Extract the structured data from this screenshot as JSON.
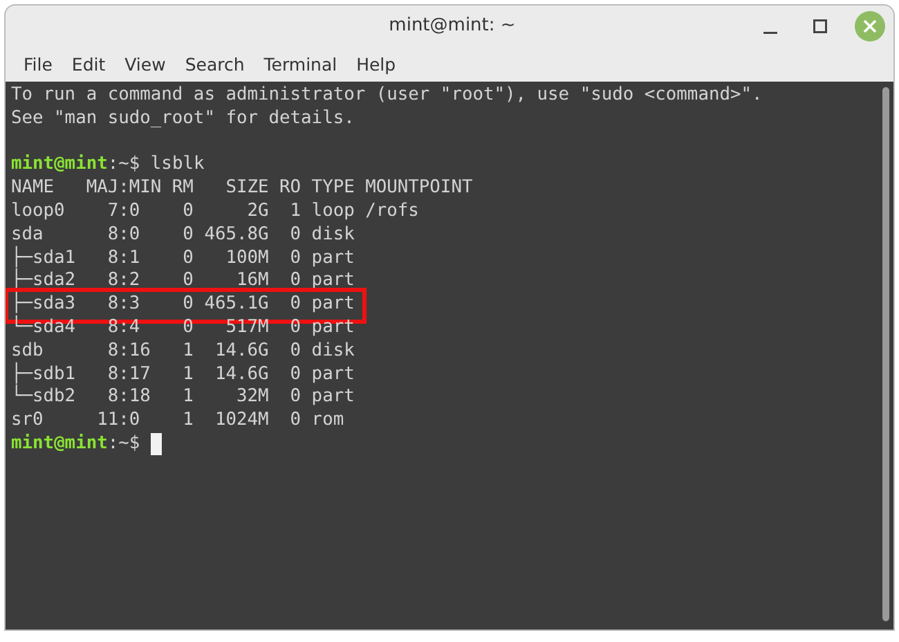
{
  "window": {
    "title": "mint@mint: ~"
  },
  "menu": [
    "File",
    "Edit",
    "View",
    "Search",
    "Terminal",
    "Help"
  ],
  "terminal": {
    "lines": [
      {
        "kind": "output",
        "text": "To run a command as administrator (user \"root\"), use \"sudo <command>\".",
        "highlighted": false
      },
      {
        "kind": "output",
        "text": "See \"man sudo_root\" for details.",
        "highlighted": false
      },
      {
        "kind": "blank"
      },
      {
        "kind": "prompt",
        "user": "mint@mint",
        "path": ":~$",
        "command": "lsblk",
        "cursor": false
      },
      {
        "kind": "output",
        "text": "NAME   MAJ:MIN RM   SIZE RO TYPE MOUNTPOINT",
        "highlighted": false
      },
      {
        "kind": "output",
        "text": "loop0    7:0    0     2G  1 loop /rofs",
        "highlighted": false
      },
      {
        "kind": "output",
        "text": "sda      8:0    0 465.8G  0 disk ",
        "highlighted": false
      },
      {
        "kind": "output",
        "text": "├─sda1   8:1    0   100M  0 part ",
        "highlighted": false
      },
      {
        "kind": "output",
        "text": "├─sda2   8:2    0    16M  0 part ",
        "highlighted": false
      },
      {
        "kind": "output",
        "text": "├─sda3   8:3    0 465.1G  0 part ",
        "highlighted": true
      },
      {
        "kind": "output",
        "text": "└─sda4   8:4    0   517M  0 part ",
        "highlighted": false
      },
      {
        "kind": "output",
        "text": "sdb      8:16   1  14.6G  0 disk ",
        "highlighted": false
      },
      {
        "kind": "output",
        "text": "├─sdb1   8:17   1  14.6G  0 part ",
        "highlighted": false
      },
      {
        "kind": "output",
        "text": "└─sdb2   8:18   1    32M  0 part ",
        "highlighted": false
      },
      {
        "kind": "output",
        "text": "sr0     11:0    1  1024M  0 rom  ",
        "highlighted": false
      },
      {
        "kind": "prompt",
        "user": "mint@mint",
        "path": ":~$",
        "cursor": true
      }
    ]
  }
}
